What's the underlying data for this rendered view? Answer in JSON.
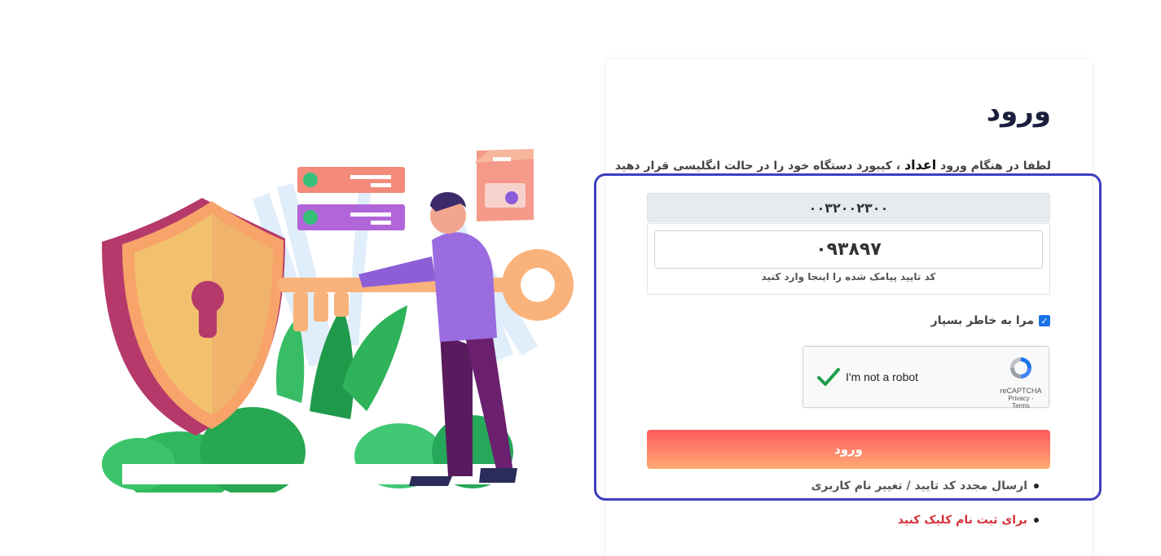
{
  "login": {
    "title": "ورود",
    "hint_prefix": "لطفا در هنگام ورود",
    "hint_bold": "اعداد",
    "hint_suffix": "، کیبورد دستگاه خود را در حالت انگلیسی قرار دهید",
    "username": "۰۰۳۲۰۰۲۳۰۰",
    "otp_value": "۰۹۳۸۹۷",
    "otp_help": "کد تایید پیامک شده را اینجا وارد کنید",
    "remember_label": "مرا به خاطر بسپار",
    "remember_checked": true,
    "recaptcha": {
      "label": "I'm not a robot",
      "brand": "reCAPTCHA",
      "links": "Privacy - Terms"
    },
    "submit_label": "ورود",
    "resend_link": "ارسال مجدد کد تایید / تغییر نام کاربری",
    "register_link": "برای ثبت نام کلیک کنید"
  },
  "colors": {
    "accent_from": "#ff5a5f",
    "accent_to": "#ffab73",
    "register_link": "#d6313a",
    "highlight_border": "#3d3fbf",
    "checkbox": "#1a73e8"
  },
  "illustration": {
    "icon": "shield-key-illustration-icon"
  }
}
